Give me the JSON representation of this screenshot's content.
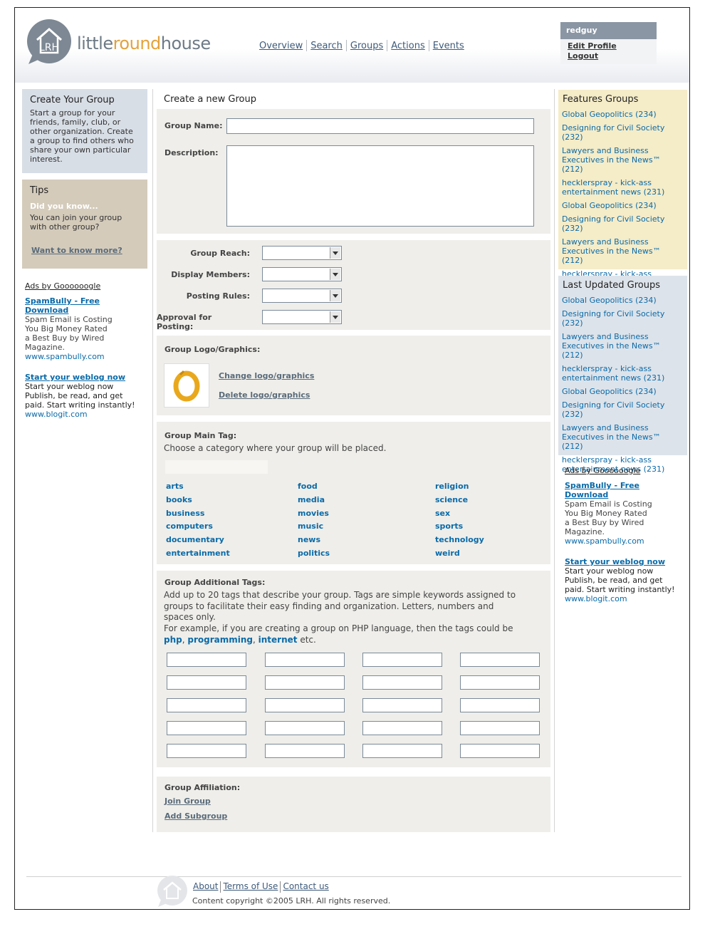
{
  "logo": {
    "pre": "little",
    "mid": "round",
    "post": "house",
    "badge": "LRH"
  },
  "nav": [
    "Overview",
    "Search",
    "Groups",
    "Actions",
    "Events"
  ],
  "user": {
    "name": "redguy",
    "edit": "Edit Profile",
    "logout": "Logout"
  },
  "left": {
    "create_title": "Create Your Group",
    "create_text": "Start a group for your friends, family, club, or other organization. Create a group to find others who share your own particular interest.",
    "tips_title": "Tips",
    "tips_sub": "Did you know...",
    "tips_text": "You can join your group with other group?",
    "tips_link": "Want to know more?"
  },
  "ads": {
    "head": "Ads by Goooooogle",
    "ad1_title": "SpamBully - Free Download",
    "ad1_body": "Spam Email is Costing You Big Money Rated a Best Buy by Wired Magazine.",
    "ad1_url": "www.spambully.com",
    "ad2_title": "Start your weblog now",
    "ad2_body": "Start your weblog now Publish, be read, and get paid. Start writing instantly!",
    "ad2_url": "www.blogit.com"
  },
  "form": {
    "title": "Create a new Group",
    "name_label": "Group Name:",
    "desc_label": "Description:",
    "reach_label": "Group Reach:",
    "display_label": "Display Members:",
    "posting_label": "Posting Rules:",
    "approval_label": "Approval for Posting:",
    "logo_label": "Group Logo/Graphics:",
    "change_logo": "Change logo/graphics",
    "delete_logo": "Delete logo/graphics",
    "main_tag_label": "Group Main Tag:",
    "main_tag_help": "Choose a category where your group will be placed.",
    "tags_col1": [
      "arts",
      "books",
      "business",
      "computers",
      "documentary",
      "entertainment"
    ],
    "tags_col2": [
      "food",
      "media",
      "movies",
      "music",
      "news",
      "politics"
    ],
    "tags_col3": [
      "religion",
      "science",
      "sex",
      "sports",
      "technology",
      "weird"
    ],
    "add_tags_label": "Group Additional Tags:",
    "add_tags_help": "Add up to 20 tags that describe your group.  Tags are simple keywords assigned to groups to facilitate their easy finding and organization. Letters, numbers and spaces only.",
    "add_tags_example": "For example, if you are creating a group on PHP language, then the tags could be",
    "example_tags": [
      "php",
      "programming",
      "internet"
    ],
    "example_end": "etc.",
    "affiliation_label": "Group Affiliation:",
    "join": "Join Group",
    "subgroup": "Add Subgroup"
  },
  "right": {
    "features_title": "Features Groups",
    "updated_title": "Last Updated Groups",
    "groups": [
      "Global Geopolitics (234)",
      "Designing for Civil Society (232)",
      "Lawyers and Business Executives in the News™ (212)",
      "hecklerspray - kick-ass entertainment news (231)",
      "Global Geopolitics (234)",
      "Designing for Civil Society (232)",
      "Lawyers and Business Executives in the News™ (212)",
      "hecklerspray - kick-ass entertainment news (231)"
    ]
  },
  "footer": {
    "links": [
      "About",
      "Terms of Use",
      "Contact us"
    ],
    "copyright": "Content copyright ©2005 LRH. All rights reserved."
  },
  "colors": {
    "accent": "#e3a23b",
    "link": "#0a6aa8",
    "features_bg": "#f5ecc8",
    "updated_bg": "#dde3ea",
    "create_bg": "#d8dee6",
    "tips_bg": "#d4cbbb"
  }
}
